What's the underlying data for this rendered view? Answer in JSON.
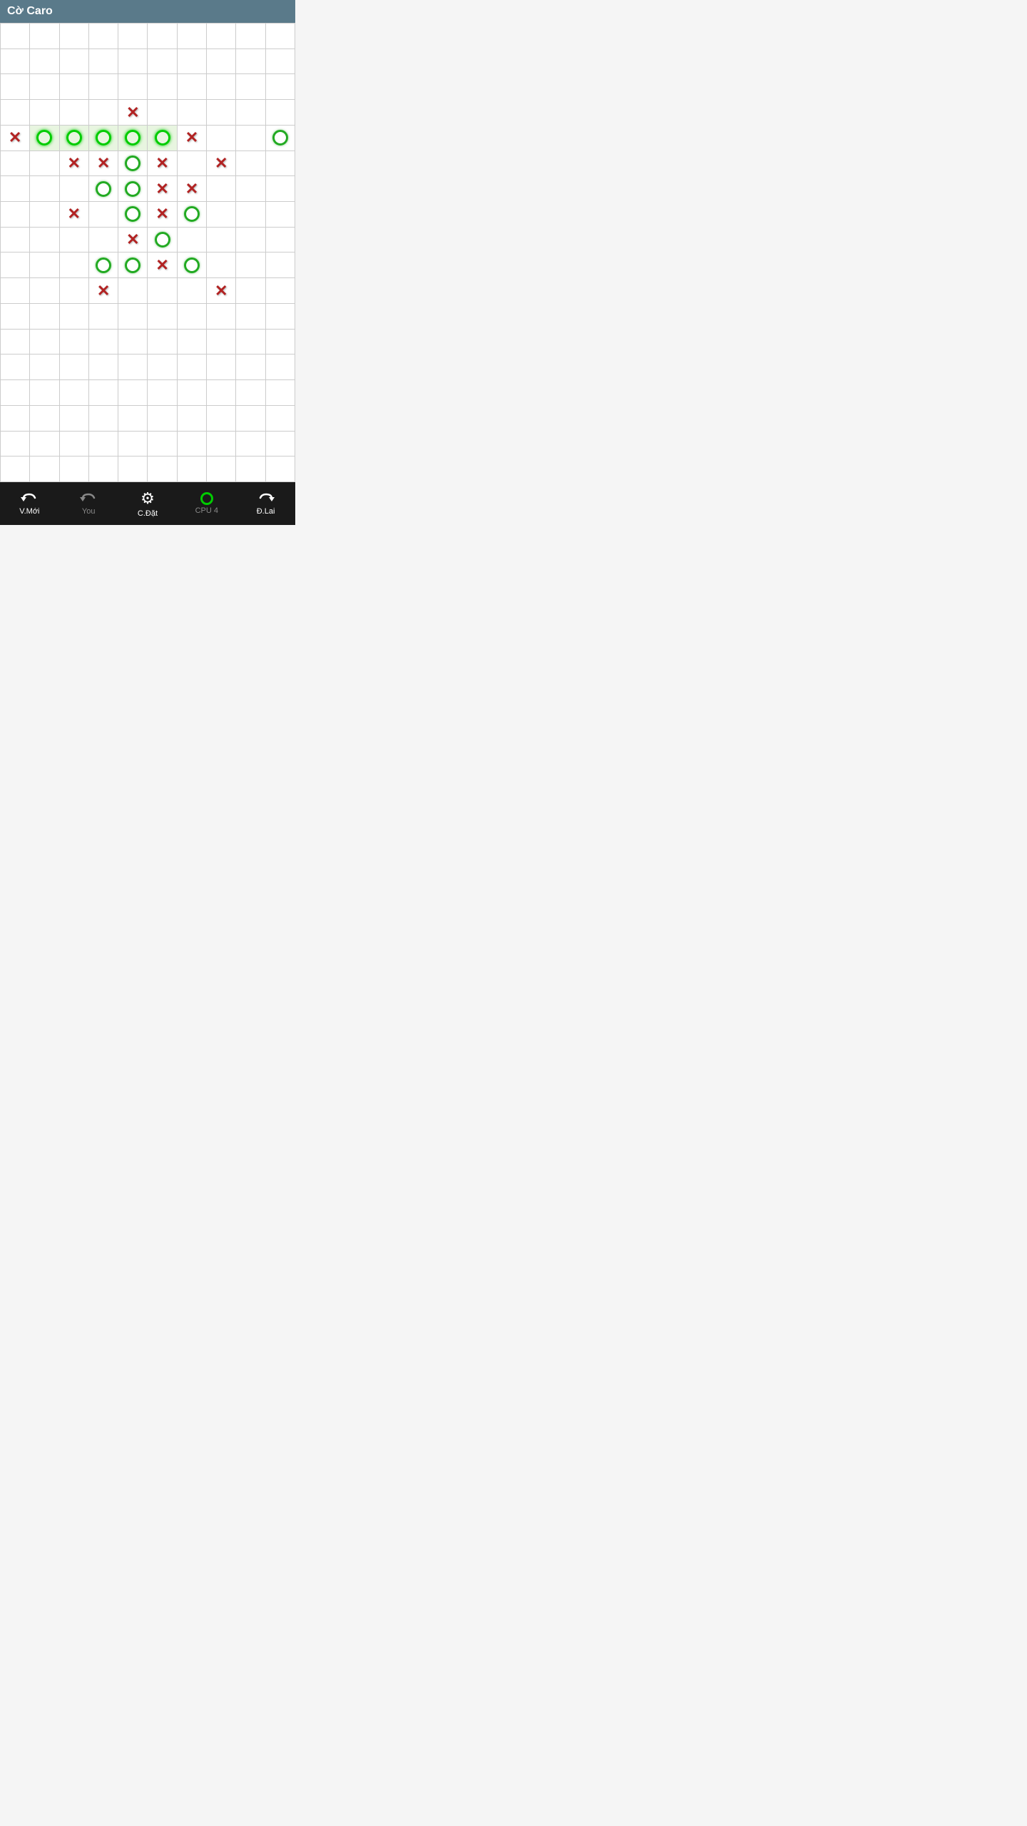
{
  "app": {
    "title": "Cờ Caro"
  },
  "toolbar": {
    "new_label": "V.Mới",
    "you_label": "You",
    "settings_label": "C.Đặt",
    "cpu_label": "CPU 4",
    "redo_label": "Đ.Lai"
  },
  "board": {
    "cols": 10,
    "rows": 18,
    "cells": [
      {
        "row": 4,
        "col": 5,
        "type": "X",
        "highlight": false
      },
      {
        "row": 5,
        "col": 1,
        "type": "X",
        "highlight": false
      },
      {
        "row": 5,
        "col": 2,
        "type": "O",
        "highlight": true
      },
      {
        "row": 5,
        "col": 3,
        "type": "O",
        "highlight": true
      },
      {
        "row": 5,
        "col": 4,
        "type": "O",
        "highlight": true
      },
      {
        "row": 5,
        "col": 5,
        "type": "O",
        "highlight": true
      },
      {
        "row": 5,
        "col": 6,
        "type": "O",
        "highlight": true
      },
      {
        "row": 5,
        "col": 7,
        "type": "X",
        "highlight": false
      },
      {
        "row": 5,
        "col": 10,
        "type": "O",
        "highlight": false
      },
      {
        "row": 6,
        "col": 3,
        "type": "X",
        "highlight": false
      },
      {
        "row": 6,
        "col": 4,
        "type": "X",
        "highlight": false
      },
      {
        "row": 6,
        "col": 5,
        "type": "O",
        "highlight": false
      },
      {
        "row": 6,
        "col": 6,
        "type": "X",
        "highlight": false
      },
      {
        "row": 6,
        "col": 8,
        "type": "X",
        "highlight": false
      },
      {
        "row": 7,
        "col": 4,
        "type": "O",
        "highlight": false
      },
      {
        "row": 7,
        "col": 5,
        "type": "O",
        "highlight": false
      },
      {
        "row": 7,
        "col": 6,
        "type": "X",
        "highlight": false
      },
      {
        "row": 7,
        "col": 7,
        "type": "X",
        "highlight": false
      },
      {
        "row": 8,
        "col": 3,
        "type": "X",
        "highlight": false
      },
      {
        "row": 8,
        "col": 5,
        "type": "O",
        "highlight": false
      },
      {
        "row": 8,
        "col": 6,
        "type": "X",
        "highlight": false
      },
      {
        "row": 8,
        "col": 7,
        "type": "O",
        "highlight": false
      },
      {
        "row": 9,
        "col": 5,
        "type": "X",
        "highlight": false
      },
      {
        "row": 9,
        "col": 6,
        "type": "O",
        "highlight": false
      },
      {
        "row": 10,
        "col": 4,
        "type": "O",
        "highlight": false
      },
      {
        "row": 10,
        "col": 5,
        "type": "O",
        "highlight": false
      },
      {
        "row": 10,
        "col": 6,
        "type": "X",
        "highlight": false
      },
      {
        "row": 10,
        "col": 7,
        "type": "O",
        "highlight": false
      },
      {
        "row": 11,
        "col": 4,
        "type": "X",
        "highlight": false
      },
      {
        "row": 11,
        "col": 8,
        "type": "X",
        "highlight": false
      }
    ]
  }
}
